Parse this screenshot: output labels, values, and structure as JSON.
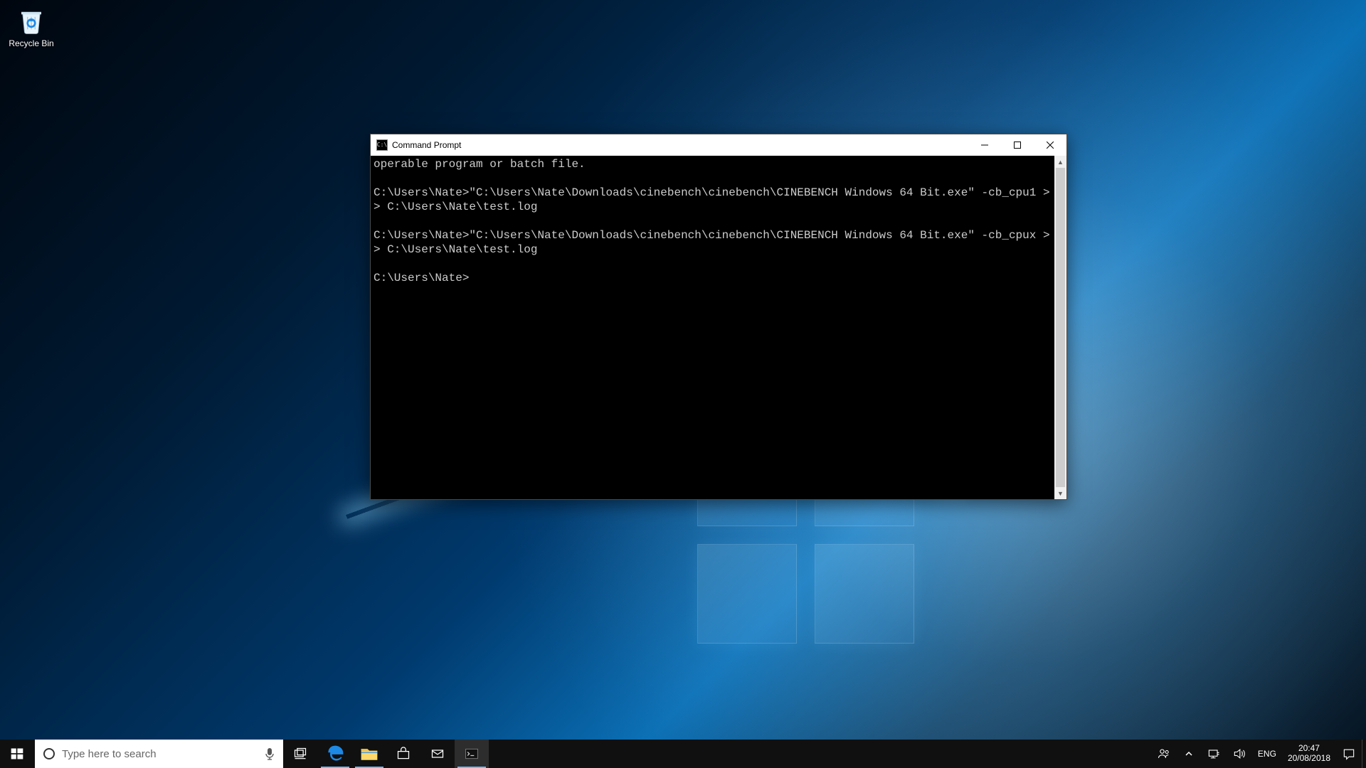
{
  "desktop": {
    "recycle_bin_label": "Recycle Bin"
  },
  "cmd": {
    "title": "Command Prompt",
    "icon_text": "C:\\",
    "lines": [
      "operable program or batch file.",
      "",
      "C:\\Users\\Nate>\"C:\\Users\\Nate\\Downloads\\cinebench\\cinebench\\CINEBENCH Windows 64 Bit.exe\" -cb_cpu1 >> C:\\Users\\Nate\\test.log",
      "",
      "C:\\Users\\Nate>\"C:\\Users\\Nate\\Downloads\\cinebench\\cinebench\\CINEBENCH Windows 64 Bit.exe\" -cb_cpux >> C:\\Users\\Nate\\test.log",
      "",
      "C:\\Users\\Nate>"
    ]
  },
  "taskbar": {
    "search_placeholder": "Type here to search"
  },
  "tray": {
    "language": "ENG",
    "time": "20:47",
    "date": "20/08/2018"
  }
}
